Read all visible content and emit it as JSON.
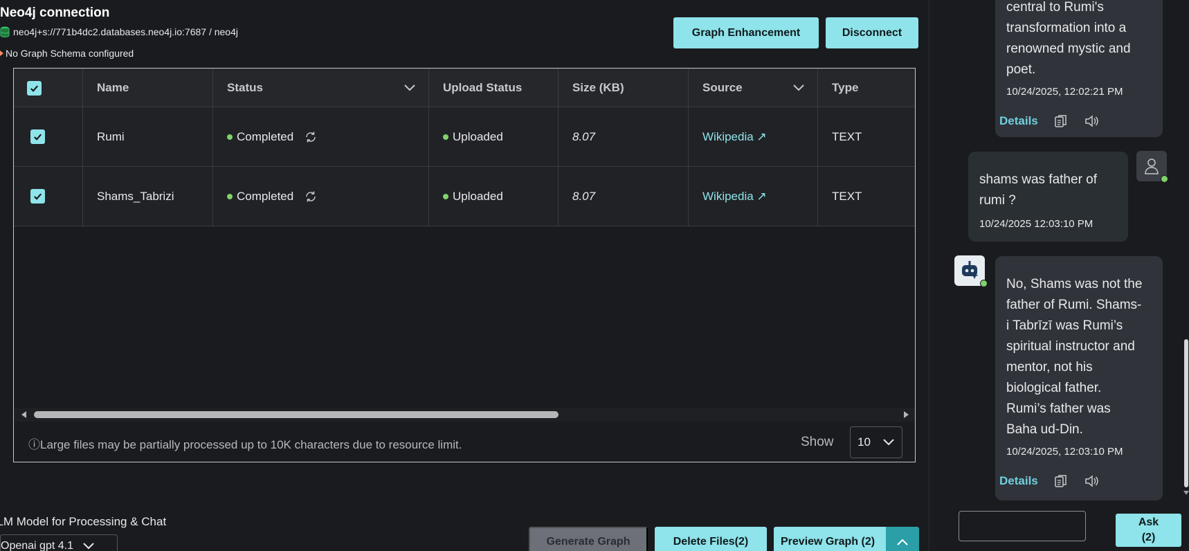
{
  "connection": {
    "title": "Neo4j connection",
    "uri": "neo4j+s://771b4dc2.databases.neo4j.io:7687 / neo4j",
    "schema_status": "No Graph Schema configured"
  },
  "actions": {
    "graph_enhancement": "Graph Enhancement",
    "disconnect": "Disconnect",
    "generate_graph": "Generate Graph",
    "delete_files": "Delete Files(2)",
    "preview_graph": "Preview Graph (2)"
  },
  "table": {
    "headers": {
      "name": "Name",
      "status": "Status",
      "upload_status": "Upload Status",
      "size": "Size (KB)",
      "source": "Source",
      "type": "Type"
    },
    "rows": [
      {
        "name": "Rumi",
        "status": "Completed",
        "upload_status": "Uploaded",
        "size": "8.07",
        "source": "Wikipedia ↗",
        "type": "TEXT",
        "checked": true
      },
      {
        "name": "Shams_Tabrizi",
        "status": "Completed",
        "upload_status": "Uploaded",
        "size": "8.07",
        "source": "Wikipedia ↗",
        "type": "TEXT",
        "checked": true
      }
    ],
    "footer_note": "ⓘLarge files may be partially processed up to 10K characters due to resource limit.",
    "show_label": "Show",
    "page_size": "10"
  },
  "llm": {
    "label": "LLM Model for Processing & Chat",
    "selected": "Openai gpt 4.1"
  },
  "chat": {
    "messages": [
      {
        "role": "assistant",
        "lines": [
          "central to Rumi's",
          "transformation into a",
          "renowned mystic and",
          "poet."
        ],
        "timestamp": "10/24/2025, 12:02:21 PM",
        "details": "Details"
      },
      {
        "role": "user",
        "lines": [
          "shams was father of",
          "rumi ?"
        ],
        "timestamp": "10/24/2025 12:03:10 PM"
      },
      {
        "role": "assistant",
        "lines": [
          "No, Shams was not the",
          "father of Rumi. Shams-",
          "i Tabrīzī was Rumi’s",
          "spiritual instructor and",
          "mentor, not his",
          "biological father.",
          "Rumi’s father was",
          "Baha ud-Din."
        ],
        "timestamp": "10/24/2025, 12:03:10 PM",
        "details": "Details"
      }
    ],
    "input_value": "",
    "ask_line1": "Ask",
    "ask_line2": "(2)"
  },
  "colors": {
    "accent": "#8fe3ea",
    "status_green": "#7fd36a",
    "link": "#8fe3ea"
  }
}
